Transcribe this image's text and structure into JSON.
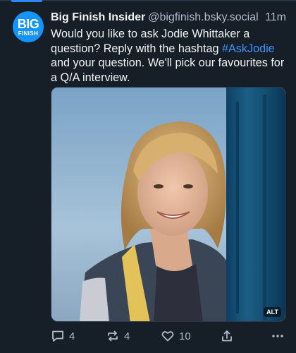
{
  "feed": {
    "post": {
      "avatar_text_1": "BIG",
      "avatar_text_2": "FINISH",
      "author_name": "Big Finish Insider",
      "handle": "@bigfinish.bsky.social",
      "timestamp": "11m",
      "text_part_1": "Would you like to ask Jodie Whittaker a question? Reply with the hashtag ",
      "hashtag": "#AskJodie",
      "text_part_2": " and your question. We'll pick our favourites for a Q/A interview.",
      "image_alt_badge": "ALT",
      "actions": {
        "reply_count": "4",
        "repost_count": "4",
        "like_count": "10"
      }
    }
  },
  "colors": {
    "background": "#161e27",
    "accent": "#2b88ff",
    "hashtag": "#3d93ff",
    "muted_text": "#aebbc9"
  },
  "icons": [
    "reply-icon",
    "repost-icon",
    "like-icon",
    "share-icon",
    "more-icon"
  ]
}
